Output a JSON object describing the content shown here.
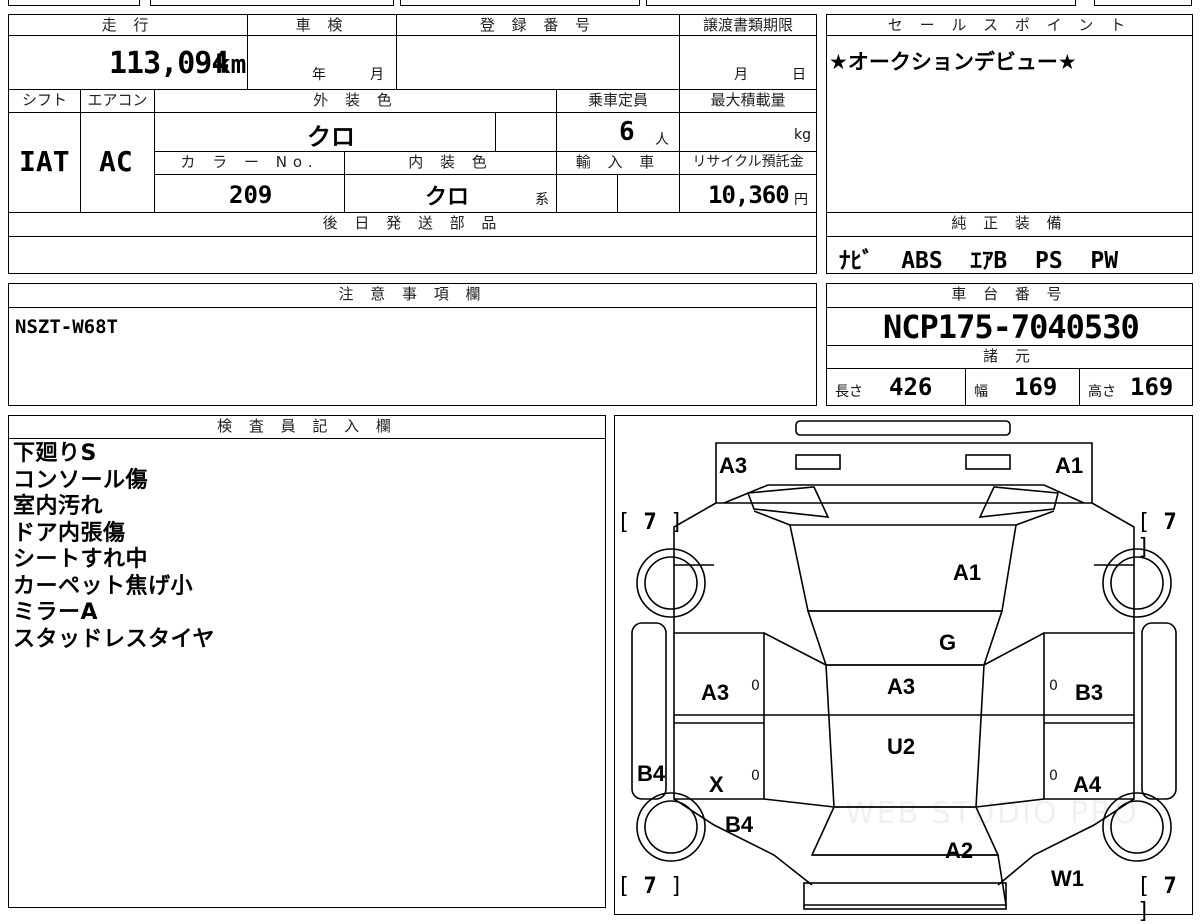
{
  "mileage": {
    "header": "走 行",
    "value": "113,094",
    "unit": "km"
  },
  "shaken": {
    "header": "車 検",
    "year_unit": "年",
    "month_unit": "月"
  },
  "registration_number": {
    "header": "登 録 番 号",
    "value": ""
  },
  "transfer_deadline": {
    "header": "譲渡書類期限",
    "month_unit": "月",
    "day_unit": "日"
  },
  "sales_point": {
    "header": "セ ー ル ス ポ イ ン ト",
    "text": "★オークションデビュー★"
  },
  "shift": {
    "header": "シフト",
    "value": "IAT"
  },
  "aircon": {
    "header": "エアコン",
    "value": "AC"
  },
  "exterior_color": {
    "header": "外 装 色",
    "value": "クロ"
  },
  "capacity": {
    "header": "乗車定員",
    "value": "6",
    "unit": "人"
  },
  "max_load": {
    "header": "最大積載量",
    "unit": "kg"
  },
  "color_no": {
    "header": "カ ラ ー No.",
    "value": "209"
  },
  "interior_color": {
    "header": "内 装 色",
    "value": "クロ",
    "suffix": "系"
  },
  "import": {
    "header": "輸 入 車"
  },
  "recycle_fee": {
    "header": "リサイクル預託金",
    "value": "10,360",
    "unit": "円"
  },
  "later_parts": {
    "header": "後 日 発 送 部 品"
  },
  "genuine_equipment": {
    "header": "純 正 装 備",
    "items": "ﾅﾋﾞ  ABS  ｴｱB  PS  PW"
  },
  "notes": {
    "header": "注 意 事 項 欄",
    "text": "NSZT-W68T"
  },
  "chassis_number": {
    "header": "車 台 番 号",
    "value": "NCP175-7040530"
  },
  "specs": {
    "header": "諸 元",
    "length_label": "長さ",
    "length": "426",
    "width_label": "幅",
    "width": "169",
    "height_label": "高さ",
    "height": "169"
  },
  "inspector": {
    "header": "検 査 員 記 入 欄",
    "lines": [
      "下廻りS",
      "コンソール傷",
      "室内汚れ",
      "ドア内張傷",
      "シートすれ中",
      "カーペット焦げ小",
      "ミラーA",
      "スタッドレスタイヤ"
    ]
  },
  "diagram": {
    "marks": {
      "front_left": "A3",
      "front_right": "A1",
      "hood": "A1",
      "windshield": "G",
      "roof": "A3",
      "roof_rear": "U2",
      "trunk": "A2",
      "front_door_left": "A3",
      "front_door_right": "B3",
      "rear_door_left": "X",
      "rear_door_right": "A4",
      "sill_left": "B4",
      "rear_fender_left": "B4",
      "rear_right": "W1",
      "zero": "0"
    },
    "tires": {
      "front_left": "7",
      "front_right": "7",
      "rear_left": "7",
      "rear_right": "7"
    },
    "watermark": "WEB STUDIO PRO"
  }
}
